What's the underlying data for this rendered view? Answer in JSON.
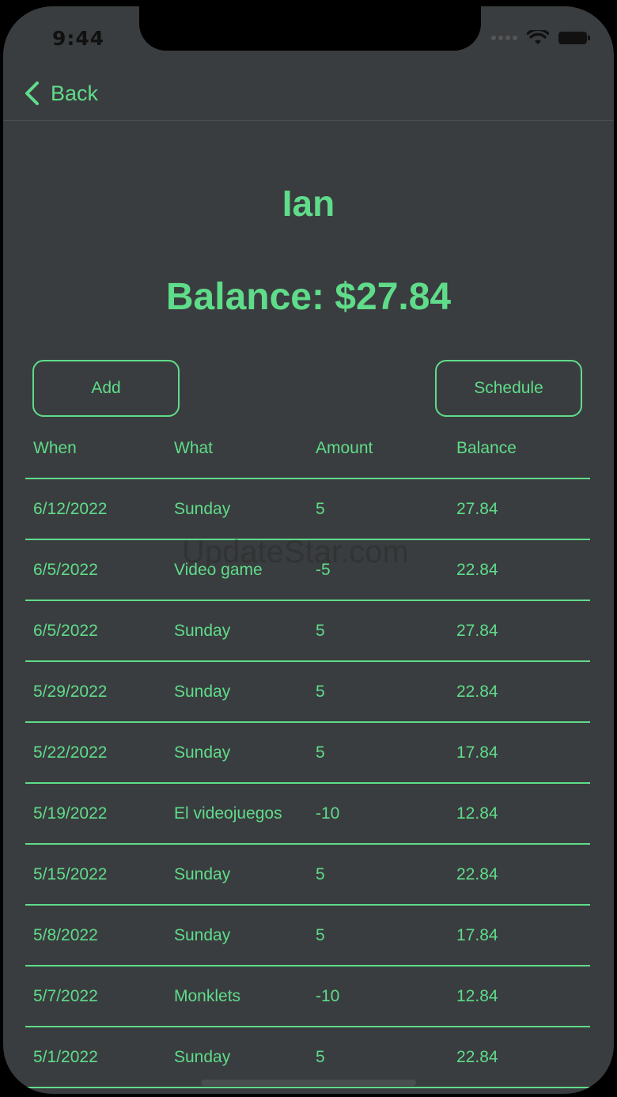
{
  "status_bar": {
    "time": "9:44"
  },
  "nav": {
    "back_label": "Back"
  },
  "profile": {
    "name": "Ian",
    "balance_text": "Balance: $27.84"
  },
  "actions": {
    "add_label": "Add",
    "schedule_label": "Schedule"
  },
  "table": {
    "headers": [
      "When",
      "What",
      "Amount",
      "Balance"
    ],
    "rows": [
      {
        "when": "6/12/2022",
        "what": "Sunday",
        "amount": "5",
        "balance": "27.84"
      },
      {
        "when": "6/5/2022",
        "what": "Video game",
        "amount": "-5",
        "balance": "22.84"
      },
      {
        "when": "6/5/2022",
        "what": "Sunday",
        "amount": "5",
        "balance": "27.84"
      },
      {
        "when": "5/29/2022",
        "what": "Sunday",
        "amount": "5",
        "balance": "22.84"
      },
      {
        "when": "5/22/2022",
        "what": "Sunday",
        "amount": "5",
        "balance": "17.84"
      },
      {
        "when": "5/19/2022",
        "what": "El videojuegos",
        "amount": "-10",
        "balance": "12.84"
      },
      {
        "when": "5/15/2022",
        "what": "Sunday",
        "amount": "5",
        "balance": "22.84"
      },
      {
        "when": "5/8/2022",
        "what": "Sunday",
        "amount": "5",
        "balance": "17.84"
      },
      {
        "when": "5/7/2022",
        "what": "Monklets",
        "amount": "-10",
        "balance": "12.84"
      },
      {
        "when": "5/1/2022",
        "what": "Sunday",
        "amount": "5",
        "balance": "22.84"
      }
    ]
  },
  "watermark": "UpdateStar.com",
  "colors": {
    "accent": "#5fdc8a",
    "background": "#3a3d3f"
  }
}
